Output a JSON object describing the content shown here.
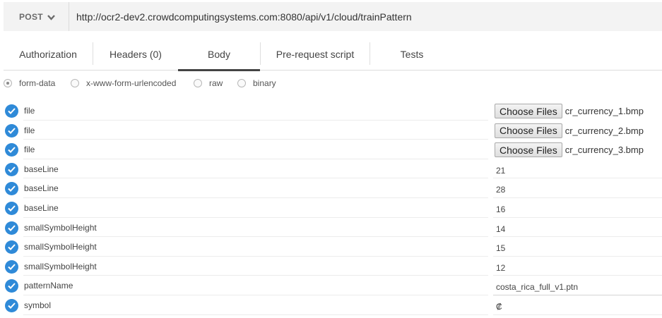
{
  "request": {
    "method": "POST",
    "url": "http://ocr2-dev2.crowdcomputingsystems.com:8080/api/v1/cloud/trainPattern"
  },
  "tabs": [
    {
      "label": "Authorization"
    },
    {
      "label": "Headers (0)"
    },
    {
      "label": "Body"
    },
    {
      "label": "Pre-request script"
    },
    {
      "label": "Tests"
    }
  ],
  "active_tab": "Body",
  "body_types": [
    {
      "label": "form-data",
      "checked": true
    },
    {
      "label": "x-www-form-urlencoded",
      "checked": false
    },
    {
      "label": "raw",
      "checked": false
    },
    {
      "label": "binary",
      "checked": false
    }
  ],
  "choose_files_label": "Choose Files",
  "params": [
    {
      "key": "file",
      "type": "file",
      "value": "cr_currency_1.bmp",
      "enabled": true
    },
    {
      "key": "file",
      "type": "file",
      "value": "cr_currency_2.bmp",
      "enabled": true
    },
    {
      "key": "file",
      "type": "file",
      "value": "cr_currency_3.bmp",
      "enabled": true
    },
    {
      "key": "baseLine",
      "type": "text",
      "value": "21",
      "enabled": true
    },
    {
      "key": "baseLine",
      "type": "text",
      "value": "28",
      "enabled": true
    },
    {
      "key": "baseLine",
      "type": "text",
      "value": "16",
      "enabled": true
    },
    {
      "key": "smallSymbolHeight",
      "type": "text",
      "value": "14",
      "enabled": true
    },
    {
      "key": "smallSymbolHeight",
      "type": "text",
      "value": "15",
      "enabled": true
    },
    {
      "key": "smallSymbolHeight",
      "type": "text",
      "value": "12",
      "enabled": true
    },
    {
      "key": "patternName",
      "type": "text",
      "value": "costa_rica_full_v1.ptn",
      "enabled": true
    },
    {
      "key": "symbol",
      "type": "text",
      "value": "₡",
      "enabled": true
    }
  ],
  "colors": {
    "check_blue": "#2f8ad8",
    "url_bar_bg": "#f3f3f3",
    "active_tab_underline": "#444444"
  }
}
